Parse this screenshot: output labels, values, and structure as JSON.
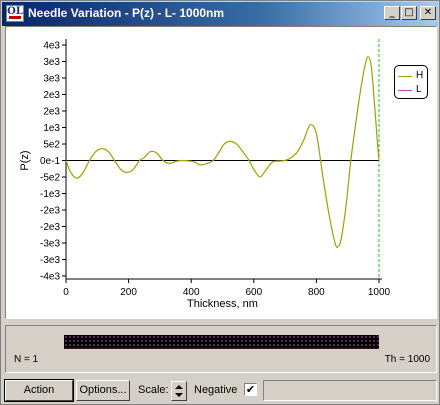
{
  "window": {
    "title": "Needle Variation - P(z) - L- 1000nm",
    "app_icon_text": "OL",
    "buttons": {
      "minimize": "_",
      "maximize": "□",
      "close": "✕"
    }
  },
  "legend": [
    {
      "name": "H",
      "color": "#a0a000"
    },
    {
      "name": "L",
      "color": "#c040c0"
    }
  ],
  "chart_data": {
    "type": "line",
    "xlabel": "Thickness, nm",
    "ylabel": "P(z)",
    "xlim": [
      0,
      1000
    ],
    "ylim": [
      -4000,
      4000
    ],
    "x_ticks": [
      "0",
      "200",
      "400",
      "600",
      "800",
      "1000"
    ],
    "y_ticks": [
      "4e3",
      "3e3",
      "3e3",
      "2e3",
      "2e3",
      "1e3",
      "5e2",
      "0e-1",
      "-5e2",
      "-1e3",
      "-2e3",
      "-2e3",
      "-3e3",
      "-3e3",
      "-4e3"
    ],
    "series": [
      {
        "name": "H",
        "color": "#a0a000",
        "x": [
          0,
          15,
          35,
          55,
          75,
          95,
          115,
          135,
          155,
          175,
          195,
          215,
          235,
          250,
          270,
          290,
          310,
          330,
          350,
          370,
          390,
          410,
          430,
          450,
          470,
          490,
          505,
          525,
          545,
          565,
          585,
          600,
          620,
          640,
          660,
          680,
          700,
          720,
          740,
          760,
          780,
          800,
          820,
          840,
          860,
          870,
          880,
          895,
          910,
          925,
          940,
          955,
          965,
          975,
          985,
          995,
          1000
        ],
        "y": [
          0,
          -400,
          -600,
          -400,
          0,
          300,
          400,
          300,
          0,
          -300,
          -400,
          -300,
          0,
          100,
          300,
          250,
          0,
          -100,
          -30,
          0,
          -10,
          -50,
          -150,
          -100,
          0,
          300,
          550,
          650,
          550,
          300,
          0,
          -300,
          -550,
          -300,
          -50,
          -20,
          0,
          100,
          300,
          700,
          1200,
          900,
          -500,
          -1800,
          -2800,
          -2900,
          -2600,
          -1500,
          0,
          1200,
          2300,
          3200,
          3500,
          3200,
          2000,
          600,
          0
        ]
      }
    ],
    "x_marker": 1000,
    "zero_line": true
  },
  "bottom": {
    "n_label": "N = 1",
    "th_label": "Th = 1000"
  },
  "toolbar": {
    "action_label": "Action",
    "options_label": "Options...",
    "scale_label": "Scale:",
    "negative_label": "Negative",
    "negative_checked": "✔"
  }
}
